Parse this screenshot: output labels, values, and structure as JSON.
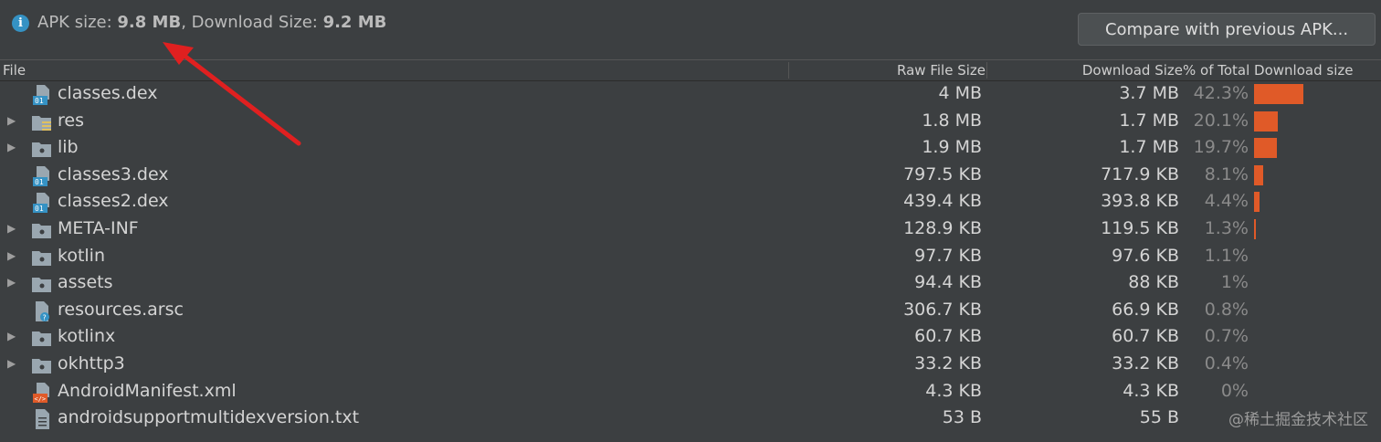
{
  "summary": {
    "apk_label": "APK size: ",
    "apk_value": "9.8 MB",
    "sep": ", Download Size: ",
    "download_value": "9.2 MB"
  },
  "compare_button": "Compare with previous APK...",
  "columns": {
    "file": "File",
    "raw": "Raw File Size",
    "download": "Download Size",
    "percent": "% of Total Download size"
  },
  "rows": [
    {
      "name": "classes.dex",
      "raw": "4 MB",
      "download": "3.7 MB",
      "percent": "42.3%",
      "share": 0.423,
      "expandable": false,
      "icon": "dex-file-icon"
    },
    {
      "name": "res",
      "raw": "1.8 MB",
      "download": "1.7 MB",
      "percent": "20.1%",
      "share": 0.201,
      "expandable": true,
      "icon": "res-folder-icon"
    },
    {
      "name": "lib",
      "raw": "1.9 MB",
      "download": "1.7 MB",
      "percent": "19.7%",
      "share": 0.197,
      "expandable": true,
      "icon": "folder-icon"
    },
    {
      "name": "classes3.dex",
      "raw": "797.5 KB",
      "download": "717.9 KB",
      "percent": "8.1%",
      "share": 0.081,
      "expandable": false,
      "icon": "dex-file-icon"
    },
    {
      "name": "classes2.dex",
      "raw": "439.4 KB",
      "download": "393.8 KB",
      "percent": "4.4%",
      "share": 0.044,
      "expandable": false,
      "icon": "dex-file-icon"
    },
    {
      "name": "META-INF",
      "raw": "128.9 KB",
      "download": "119.5 KB",
      "percent": "1.3%",
      "share": 0.013,
      "expandable": true,
      "icon": "folder-icon"
    },
    {
      "name": "kotlin",
      "raw": "97.7 KB",
      "download": "97.6 KB",
      "percent": "1.1%",
      "share": 0,
      "expandable": true,
      "icon": "folder-icon"
    },
    {
      "name": "assets",
      "raw": "94.4 KB",
      "download": "88 KB",
      "percent": "1%",
      "share": 0,
      "expandable": true,
      "icon": "folder-icon"
    },
    {
      "name": "resources.arsc",
      "raw": "306.7 KB",
      "download": "66.9 KB",
      "percent": "0.8%",
      "share": 0,
      "expandable": false,
      "icon": "unknown-file-icon"
    },
    {
      "name": "kotlinx",
      "raw": "60.7 KB",
      "download": "60.7 KB",
      "percent": "0.7%",
      "share": 0,
      "expandable": true,
      "icon": "folder-icon"
    },
    {
      "name": "okhttp3",
      "raw": "33.2 KB",
      "download": "33.2 KB",
      "percent": "0.4%",
      "share": 0,
      "expandable": true,
      "icon": "folder-icon"
    },
    {
      "name": "AndroidManifest.xml",
      "raw": "4.3 KB",
      "download": "4.3 KB",
      "percent": "0%",
      "share": 0,
      "expandable": false,
      "icon": "xml-file-icon"
    },
    {
      "name": "androidsupportmultidexversion.txt",
      "raw": "53 B",
      "download": "55 B",
      "percent": "",
      "share": 0,
      "expandable": false,
      "icon": "text-file-icon"
    }
  ],
  "watermark": "@稀土掘金技术社区",
  "colors": {
    "bar": "#e05a28",
    "annotation_arrow": "#e02020",
    "info": "#3592c4"
  }
}
